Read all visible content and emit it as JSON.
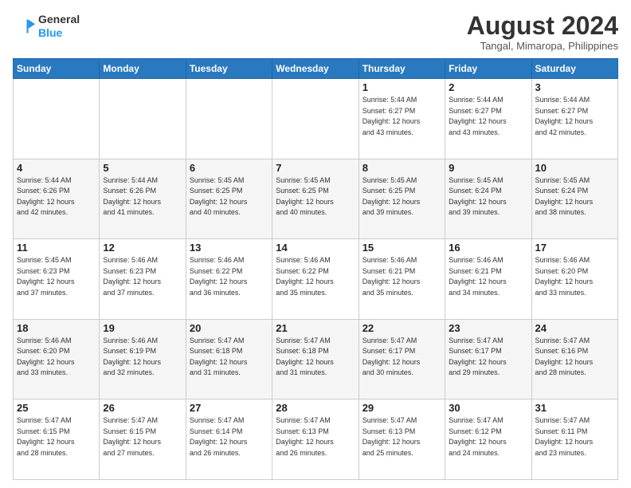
{
  "header": {
    "logo_line1": "General",
    "logo_line2": "Blue",
    "month_year": "August 2024",
    "location": "Tangal, Mimaropa, Philippines"
  },
  "weekdays": [
    "Sunday",
    "Monday",
    "Tuesday",
    "Wednesday",
    "Thursday",
    "Friday",
    "Saturday"
  ],
  "weeks": [
    [
      {
        "day": "",
        "info": ""
      },
      {
        "day": "",
        "info": ""
      },
      {
        "day": "",
        "info": ""
      },
      {
        "day": "",
        "info": ""
      },
      {
        "day": "1",
        "info": "Sunrise: 5:44 AM\nSunset: 6:27 PM\nDaylight: 12 hours\nand 43 minutes."
      },
      {
        "day": "2",
        "info": "Sunrise: 5:44 AM\nSunset: 6:27 PM\nDaylight: 12 hours\nand 43 minutes."
      },
      {
        "day": "3",
        "info": "Sunrise: 5:44 AM\nSunset: 6:27 PM\nDaylight: 12 hours\nand 42 minutes."
      }
    ],
    [
      {
        "day": "4",
        "info": "Sunrise: 5:44 AM\nSunset: 6:26 PM\nDaylight: 12 hours\nand 42 minutes."
      },
      {
        "day": "5",
        "info": "Sunrise: 5:44 AM\nSunset: 6:26 PM\nDaylight: 12 hours\nand 41 minutes."
      },
      {
        "day": "6",
        "info": "Sunrise: 5:45 AM\nSunset: 6:25 PM\nDaylight: 12 hours\nand 40 minutes."
      },
      {
        "day": "7",
        "info": "Sunrise: 5:45 AM\nSunset: 6:25 PM\nDaylight: 12 hours\nand 40 minutes."
      },
      {
        "day": "8",
        "info": "Sunrise: 5:45 AM\nSunset: 6:25 PM\nDaylight: 12 hours\nand 39 minutes."
      },
      {
        "day": "9",
        "info": "Sunrise: 5:45 AM\nSunset: 6:24 PM\nDaylight: 12 hours\nand 39 minutes."
      },
      {
        "day": "10",
        "info": "Sunrise: 5:45 AM\nSunset: 6:24 PM\nDaylight: 12 hours\nand 38 minutes."
      }
    ],
    [
      {
        "day": "11",
        "info": "Sunrise: 5:45 AM\nSunset: 6:23 PM\nDaylight: 12 hours\nand 37 minutes."
      },
      {
        "day": "12",
        "info": "Sunrise: 5:46 AM\nSunset: 6:23 PM\nDaylight: 12 hours\nand 37 minutes."
      },
      {
        "day": "13",
        "info": "Sunrise: 5:46 AM\nSunset: 6:22 PM\nDaylight: 12 hours\nand 36 minutes."
      },
      {
        "day": "14",
        "info": "Sunrise: 5:46 AM\nSunset: 6:22 PM\nDaylight: 12 hours\nand 35 minutes."
      },
      {
        "day": "15",
        "info": "Sunrise: 5:46 AM\nSunset: 6:21 PM\nDaylight: 12 hours\nand 35 minutes."
      },
      {
        "day": "16",
        "info": "Sunrise: 5:46 AM\nSunset: 6:21 PM\nDaylight: 12 hours\nand 34 minutes."
      },
      {
        "day": "17",
        "info": "Sunrise: 5:46 AM\nSunset: 6:20 PM\nDaylight: 12 hours\nand 33 minutes."
      }
    ],
    [
      {
        "day": "18",
        "info": "Sunrise: 5:46 AM\nSunset: 6:20 PM\nDaylight: 12 hours\nand 33 minutes."
      },
      {
        "day": "19",
        "info": "Sunrise: 5:46 AM\nSunset: 6:19 PM\nDaylight: 12 hours\nand 32 minutes."
      },
      {
        "day": "20",
        "info": "Sunrise: 5:47 AM\nSunset: 6:18 PM\nDaylight: 12 hours\nand 31 minutes."
      },
      {
        "day": "21",
        "info": "Sunrise: 5:47 AM\nSunset: 6:18 PM\nDaylight: 12 hours\nand 31 minutes."
      },
      {
        "day": "22",
        "info": "Sunrise: 5:47 AM\nSunset: 6:17 PM\nDaylight: 12 hours\nand 30 minutes."
      },
      {
        "day": "23",
        "info": "Sunrise: 5:47 AM\nSunset: 6:17 PM\nDaylight: 12 hours\nand 29 minutes."
      },
      {
        "day": "24",
        "info": "Sunrise: 5:47 AM\nSunset: 6:16 PM\nDaylight: 12 hours\nand 28 minutes."
      }
    ],
    [
      {
        "day": "25",
        "info": "Sunrise: 5:47 AM\nSunset: 6:15 PM\nDaylight: 12 hours\nand 28 minutes."
      },
      {
        "day": "26",
        "info": "Sunrise: 5:47 AM\nSunset: 6:15 PM\nDaylight: 12 hours\nand 27 minutes."
      },
      {
        "day": "27",
        "info": "Sunrise: 5:47 AM\nSunset: 6:14 PM\nDaylight: 12 hours\nand 26 minutes."
      },
      {
        "day": "28",
        "info": "Sunrise: 5:47 AM\nSunset: 6:13 PM\nDaylight: 12 hours\nand 26 minutes."
      },
      {
        "day": "29",
        "info": "Sunrise: 5:47 AM\nSunset: 6:13 PM\nDaylight: 12 hours\nand 25 minutes."
      },
      {
        "day": "30",
        "info": "Sunrise: 5:47 AM\nSunset: 6:12 PM\nDaylight: 12 hours\nand 24 minutes."
      },
      {
        "day": "31",
        "info": "Sunrise: 5:47 AM\nSunset: 6:11 PM\nDaylight: 12 hours\nand 23 minutes."
      }
    ]
  ]
}
